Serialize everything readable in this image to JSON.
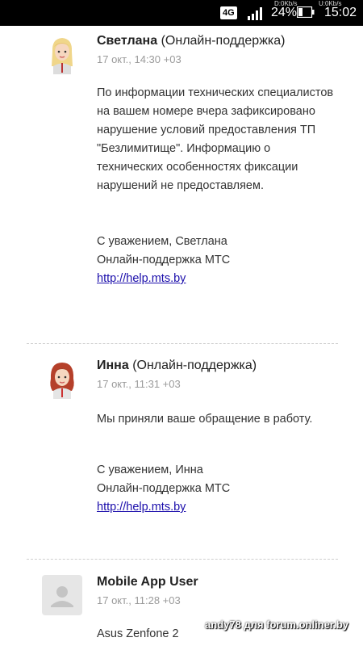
{
  "status_bar": {
    "network": "4G",
    "speed_down": "D:0Kb/s",
    "speed_up": "U:0Kb/s",
    "battery_percent": "24%",
    "time": "15:02"
  },
  "messages": [
    {
      "author": "Светлана",
      "role": "(Онлайн-поддержка)",
      "date": "17 окт., 14:30 +03",
      "paragraph1": "По информации технических специалистов на вашем номере вчера зафиксировано нарушение условий предоставления ТП \"Безлимитище\". Информацию о технических особенностях фиксации нарушений не предоставляем.",
      "sig1": "С уважением, Светлана",
      "sig2": "Онлайн-поддержка МТС",
      "link": "http://help.mts.by"
    },
    {
      "author": "Инна",
      "role": "(Онлайн-поддержка)",
      "date": "17 окт., 11:31 +03",
      "paragraph1": "Мы приняли ваше обращение в работу.",
      "sig1": "С уважением, Инна",
      "sig2": "Онлайн-поддержка МТС",
      "link": "http://help.mts.by"
    },
    {
      "author": "Mobile App User",
      "date": "17 окт., 11:28 +03",
      "paragraph1": "Asus Zenfone 2"
    }
  ],
  "watermark": "andy78 для forum.onliner.by"
}
